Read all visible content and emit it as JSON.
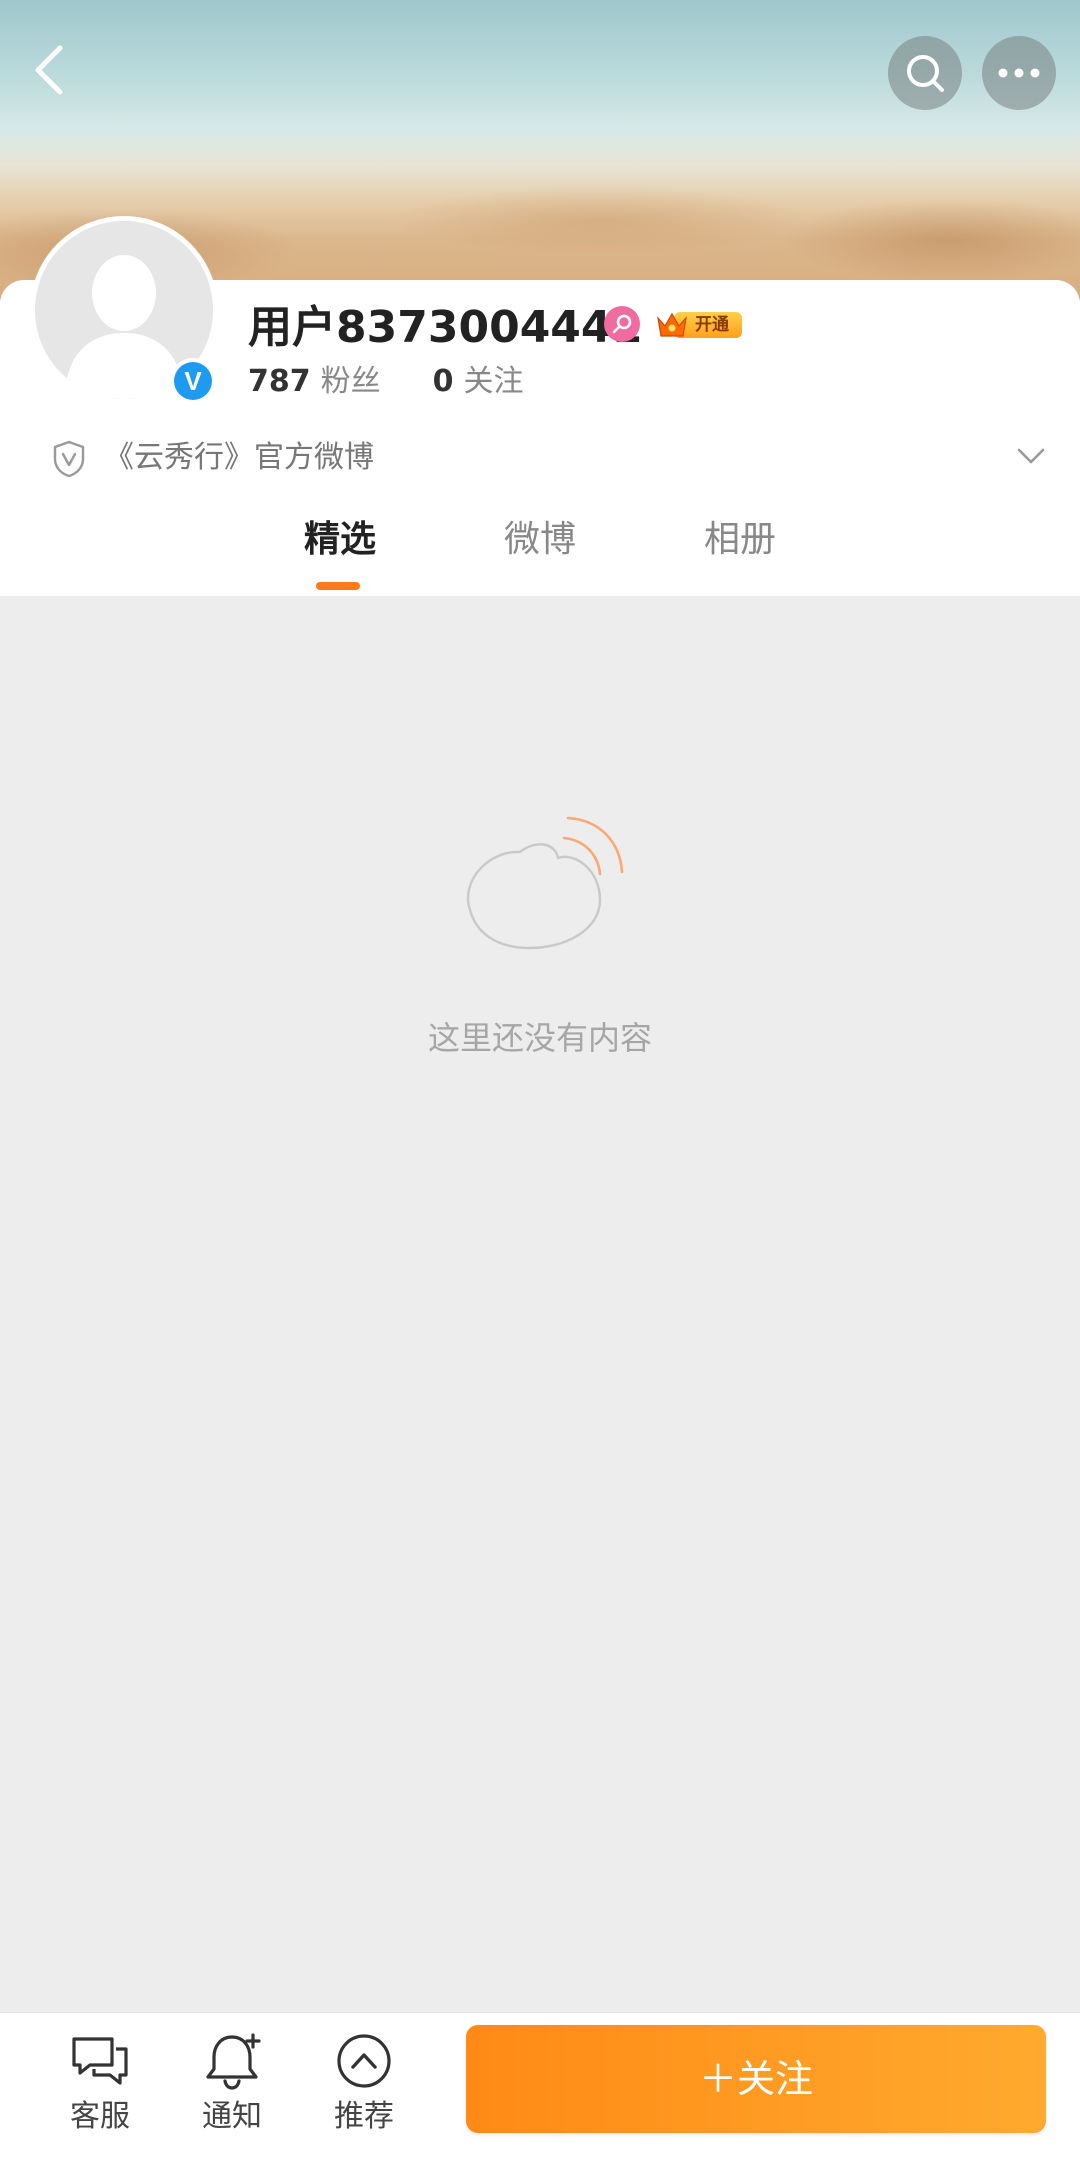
{
  "header": {
    "back_icon": "chevron-left-icon",
    "search_icon": "search-icon",
    "more_icon": "more-dots-icon"
  },
  "profile": {
    "username": "用户8373004441",
    "verified_icon": "verified-v-icon",
    "verified_mark": "V",
    "gender_icon": "female-icon",
    "vip_label": "开通",
    "followers_count": "787",
    "followers_label": "粉丝",
    "following_count": "0",
    "following_label": "关注",
    "description": "《云秀行》官方微博"
  },
  "tabs": [
    {
      "label": "精选",
      "active": true
    },
    {
      "label": "微博",
      "active": false
    },
    {
      "label": "相册",
      "active": false
    }
  ],
  "empty_state": {
    "message": "这里还没有内容"
  },
  "bottom_bar": {
    "items": [
      {
        "label": "客服",
        "icon": "chat-bubbles-icon"
      },
      {
        "label": "通知",
        "icon": "bell-plus-icon"
      },
      {
        "label": "推荐",
        "icon": "chevron-up-circle-icon"
      }
    ],
    "follow_button": "＋关注"
  },
  "colors": {
    "accent": "#ff8a15",
    "verified_blue": "#1d9bf0",
    "background": "#ededed"
  }
}
